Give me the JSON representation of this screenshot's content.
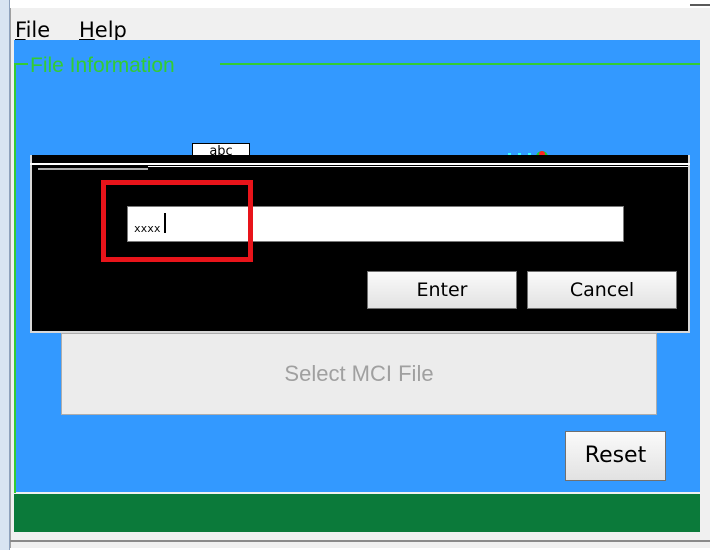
{
  "menu": {
    "file_mnemonic": "F",
    "file_rest": "ile",
    "help_mnemonic": "H",
    "help_rest": "elp"
  },
  "group": {
    "title": "File Information"
  },
  "abc_label": "abc",
  "dialog": {
    "input_value": "xxxx",
    "enter_label": "Enter",
    "cancel_label": "Cancel"
  },
  "select_file_label": "Select MCI File",
  "reset_label": "Reset",
  "colors": {
    "panel_blue": "#3399ff",
    "group_green": "#33cc33",
    "status_green": "#0b7a3a",
    "highlight_red": "#e8141a"
  }
}
